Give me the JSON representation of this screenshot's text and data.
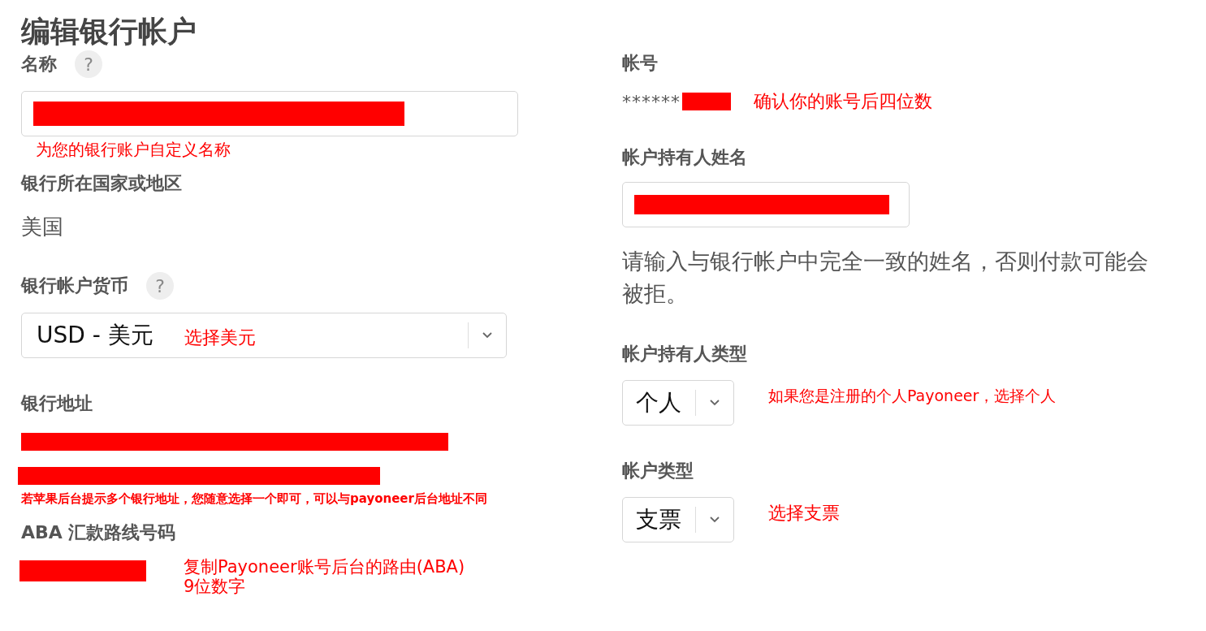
{
  "title": "编辑银行帐户",
  "left": [
    {
      "kind": "input",
      "label": "名称",
      "help": "?",
      "note": "为您的银行账户自定义名称"
    },
    {
      "kind": "static",
      "label": "银行所在国家或地区",
      "value": "美国"
    },
    {
      "kind": "select",
      "label": "银行帐户货币",
      "help": "?",
      "value": "USD - 美元",
      "note": "选择美元"
    },
    {
      "kind": "address",
      "label": "银行地址",
      "note": "若苹果后台提示多个银行地址，您随意选择一个即可，可以与payoneer后台地址不同"
    },
    {
      "kind": "redacted",
      "label": "ABA 汇款路线号码",
      "note": "复制Payoneer账号后台的路由(ABA)\n9位数字"
    }
  ],
  "right": [
    {
      "kind": "masked",
      "label": "帐号",
      "value": "******",
      "note": "确认你的账号后四位数"
    },
    {
      "kind": "input",
      "label": "帐户持有人姓名",
      "hint": "请输入与银行帐户中完全一致的姓名，否则付款可能会被拒。"
    },
    {
      "kind": "select",
      "label": "帐户持有人类型",
      "value": "个人",
      "note": "如果您是注册的个人Payoneer，选择个人"
    },
    {
      "kind": "select",
      "label": "帐户类型",
      "value": "支票",
      "note": "选择支票"
    }
  ]
}
